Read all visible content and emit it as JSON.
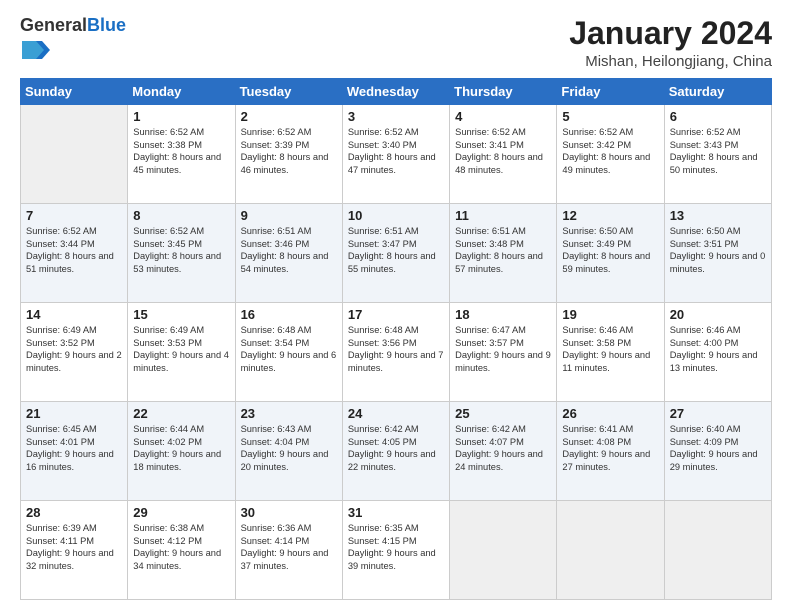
{
  "header": {
    "logo_general": "General",
    "logo_blue": "Blue",
    "month_year": "January 2024",
    "location": "Mishan, Heilongjiang, China"
  },
  "weekdays": [
    "Sunday",
    "Monday",
    "Tuesday",
    "Wednesday",
    "Thursday",
    "Friday",
    "Saturday"
  ],
  "weeks": [
    [
      {
        "day": "",
        "empty": true
      },
      {
        "day": "1",
        "sunrise": "Sunrise: 6:52 AM",
        "sunset": "Sunset: 3:38 PM",
        "daylight": "Daylight: 8 hours and 45 minutes."
      },
      {
        "day": "2",
        "sunrise": "Sunrise: 6:52 AM",
        "sunset": "Sunset: 3:39 PM",
        "daylight": "Daylight: 8 hours and 46 minutes."
      },
      {
        "day": "3",
        "sunrise": "Sunrise: 6:52 AM",
        "sunset": "Sunset: 3:40 PM",
        "daylight": "Daylight: 8 hours and 47 minutes."
      },
      {
        "day": "4",
        "sunrise": "Sunrise: 6:52 AM",
        "sunset": "Sunset: 3:41 PM",
        "daylight": "Daylight: 8 hours and 48 minutes."
      },
      {
        "day": "5",
        "sunrise": "Sunrise: 6:52 AM",
        "sunset": "Sunset: 3:42 PM",
        "daylight": "Daylight: 8 hours and 49 minutes."
      },
      {
        "day": "6",
        "sunrise": "Sunrise: 6:52 AM",
        "sunset": "Sunset: 3:43 PM",
        "daylight": "Daylight: 8 hours and 50 minutes."
      }
    ],
    [
      {
        "day": "7",
        "sunrise": "Sunrise: 6:52 AM",
        "sunset": "Sunset: 3:44 PM",
        "daylight": "Daylight: 8 hours and 51 minutes."
      },
      {
        "day": "8",
        "sunrise": "Sunrise: 6:52 AM",
        "sunset": "Sunset: 3:45 PM",
        "daylight": "Daylight: 8 hours and 53 minutes."
      },
      {
        "day": "9",
        "sunrise": "Sunrise: 6:51 AM",
        "sunset": "Sunset: 3:46 PM",
        "daylight": "Daylight: 8 hours and 54 minutes."
      },
      {
        "day": "10",
        "sunrise": "Sunrise: 6:51 AM",
        "sunset": "Sunset: 3:47 PM",
        "daylight": "Daylight: 8 hours and 55 minutes."
      },
      {
        "day": "11",
        "sunrise": "Sunrise: 6:51 AM",
        "sunset": "Sunset: 3:48 PM",
        "daylight": "Daylight: 8 hours and 57 minutes."
      },
      {
        "day": "12",
        "sunrise": "Sunrise: 6:50 AM",
        "sunset": "Sunset: 3:49 PM",
        "daylight": "Daylight: 8 hours and 59 minutes."
      },
      {
        "day": "13",
        "sunrise": "Sunrise: 6:50 AM",
        "sunset": "Sunset: 3:51 PM",
        "daylight": "Daylight: 9 hours and 0 minutes."
      }
    ],
    [
      {
        "day": "14",
        "sunrise": "Sunrise: 6:49 AM",
        "sunset": "Sunset: 3:52 PM",
        "daylight": "Daylight: 9 hours and 2 minutes."
      },
      {
        "day": "15",
        "sunrise": "Sunrise: 6:49 AM",
        "sunset": "Sunset: 3:53 PM",
        "daylight": "Daylight: 9 hours and 4 minutes."
      },
      {
        "day": "16",
        "sunrise": "Sunrise: 6:48 AM",
        "sunset": "Sunset: 3:54 PM",
        "daylight": "Daylight: 9 hours and 6 minutes."
      },
      {
        "day": "17",
        "sunrise": "Sunrise: 6:48 AM",
        "sunset": "Sunset: 3:56 PM",
        "daylight": "Daylight: 9 hours and 7 minutes."
      },
      {
        "day": "18",
        "sunrise": "Sunrise: 6:47 AM",
        "sunset": "Sunset: 3:57 PM",
        "daylight": "Daylight: 9 hours and 9 minutes."
      },
      {
        "day": "19",
        "sunrise": "Sunrise: 6:46 AM",
        "sunset": "Sunset: 3:58 PM",
        "daylight": "Daylight: 9 hours and 11 minutes."
      },
      {
        "day": "20",
        "sunrise": "Sunrise: 6:46 AM",
        "sunset": "Sunset: 4:00 PM",
        "daylight": "Daylight: 9 hours and 13 minutes."
      }
    ],
    [
      {
        "day": "21",
        "sunrise": "Sunrise: 6:45 AM",
        "sunset": "Sunset: 4:01 PM",
        "daylight": "Daylight: 9 hours and 16 minutes."
      },
      {
        "day": "22",
        "sunrise": "Sunrise: 6:44 AM",
        "sunset": "Sunset: 4:02 PM",
        "daylight": "Daylight: 9 hours and 18 minutes."
      },
      {
        "day": "23",
        "sunrise": "Sunrise: 6:43 AM",
        "sunset": "Sunset: 4:04 PM",
        "daylight": "Daylight: 9 hours and 20 minutes."
      },
      {
        "day": "24",
        "sunrise": "Sunrise: 6:42 AM",
        "sunset": "Sunset: 4:05 PM",
        "daylight": "Daylight: 9 hours and 22 minutes."
      },
      {
        "day": "25",
        "sunrise": "Sunrise: 6:42 AM",
        "sunset": "Sunset: 4:07 PM",
        "daylight": "Daylight: 9 hours and 24 minutes."
      },
      {
        "day": "26",
        "sunrise": "Sunrise: 6:41 AM",
        "sunset": "Sunset: 4:08 PM",
        "daylight": "Daylight: 9 hours and 27 minutes."
      },
      {
        "day": "27",
        "sunrise": "Sunrise: 6:40 AM",
        "sunset": "Sunset: 4:09 PM",
        "daylight": "Daylight: 9 hours and 29 minutes."
      }
    ],
    [
      {
        "day": "28",
        "sunrise": "Sunrise: 6:39 AM",
        "sunset": "Sunset: 4:11 PM",
        "daylight": "Daylight: 9 hours and 32 minutes."
      },
      {
        "day": "29",
        "sunrise": "Sunrise: 6:38 AM",
        "sunset": "Sunset: 4:12 PM",
        "daylight": "Daylight: 9 hours and 34 minutes."
      },
      {
        "day": "30",
        "sunrise": "Sunrise: 6:36 AM",
        "sunset": "Sunset: 4:14 PM",
        "daylight": "Daylight: 9 hours and 37 minutes."
      },
      {
        "day": "31",
        "sunrise": "Sunrise: 6:35 AM",
        "sunset": "Sunset: 4:15 PM",
        "daylight": "Daylight: 9 hours and 39 minutes."
      },
      {
        "day": "",
        "empty": true
      },
      {
        "day": "",
        "empty": true
      },
      {
        "day": "",
        "empty": true
      }
    ]
  ]
}
